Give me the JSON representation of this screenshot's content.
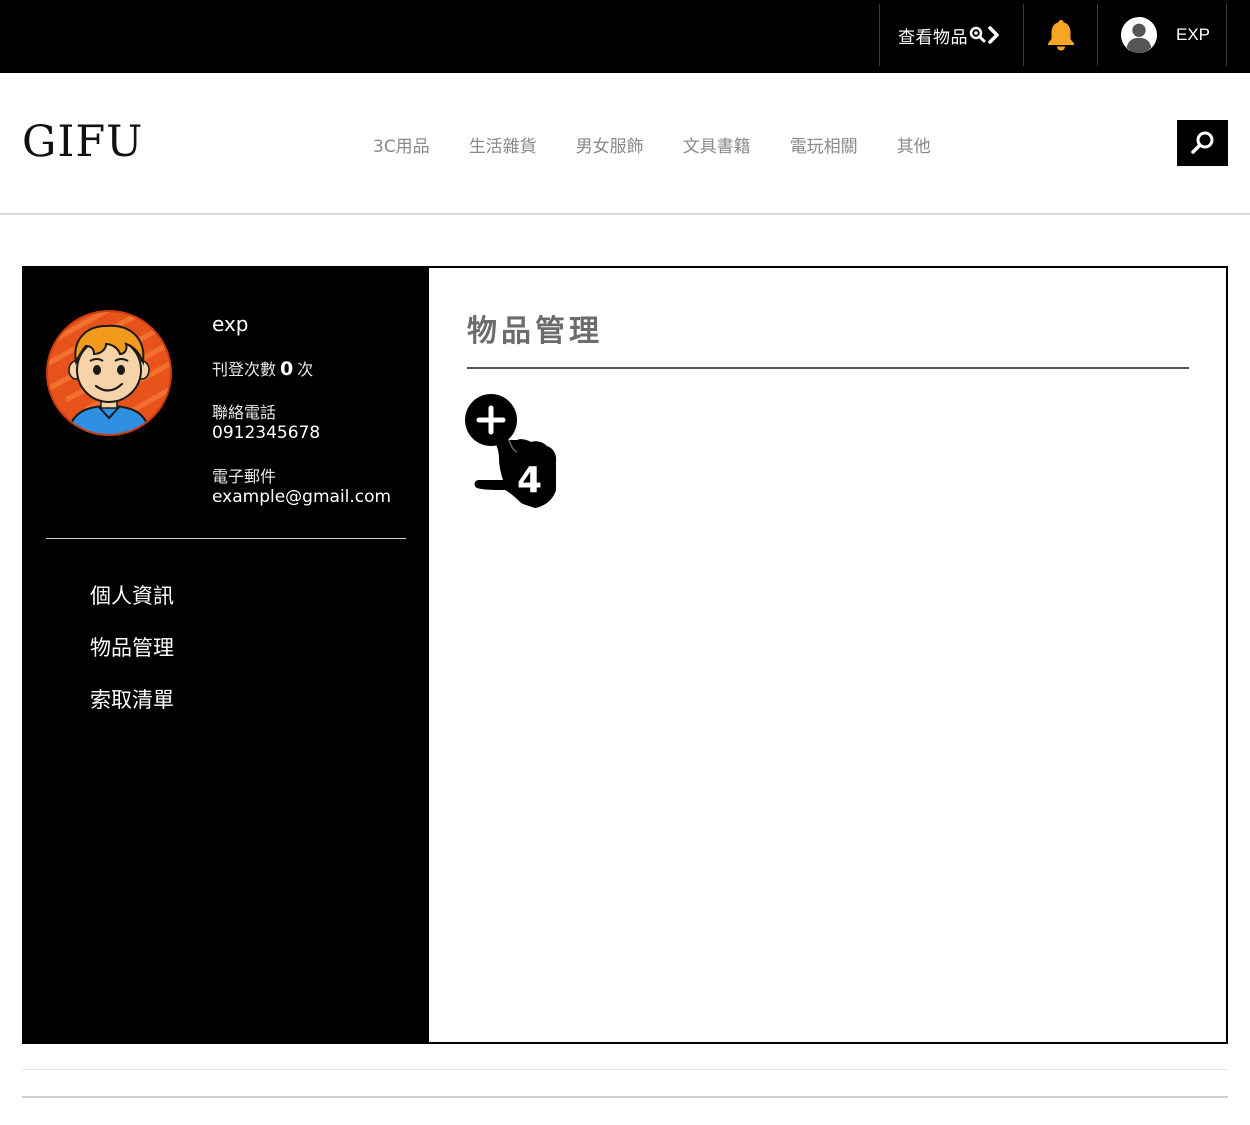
{
  "topbar": {
    "view_items_label": "查看物品",
    "view_items_icon": "search-magnifier-icon",
    "bell_icon": "bell-icon",
    "user_icon": "user-avatar-icon",
    "username": "EXP"
  },
  "header": {
    "logo": "GIFU",
    "nav": [
      {
        "label": "3C用品"
      },
      {
        "label": "生活雜貨"
      },
      {
        "label": "男女服飾"
      },
      {
        "label": "文具書籍"
      },
      {
        "label": "電玩相關"
      },
      {
        "label": "其他"
      }
    ],
    "search_icon": "search-icon"
  },
  "profile": {
    "name": "exp",
    "posts_label": "刊登次數",
    "posts_count": "0",
    "posts_unit": "次",
    "phone_label": "聯絡電話",
    "phone": "0912345678",
    "email_label": "電子郵件",
    "email": "example@gmail.com"
  },
  "side_menu": [
    {
      "label": "個人資訊"
    },
    {
      "label": "物品管理"
    },
    {
      "label": "索取清單"
    }
  ],
  "content": {
    "title": "物品管理",
    "add_button_icon": "add-item-hand-icon",
    "add_button_count": "4"
  },
  "colors": {
    "topbar_bg": "#000000",
    "sidebar_bg": "#000000",
    "bell": "#f5a623",
    "nav_text": "#8a8a8a",
    "title_text": "#6c6c6c"
  }
}
